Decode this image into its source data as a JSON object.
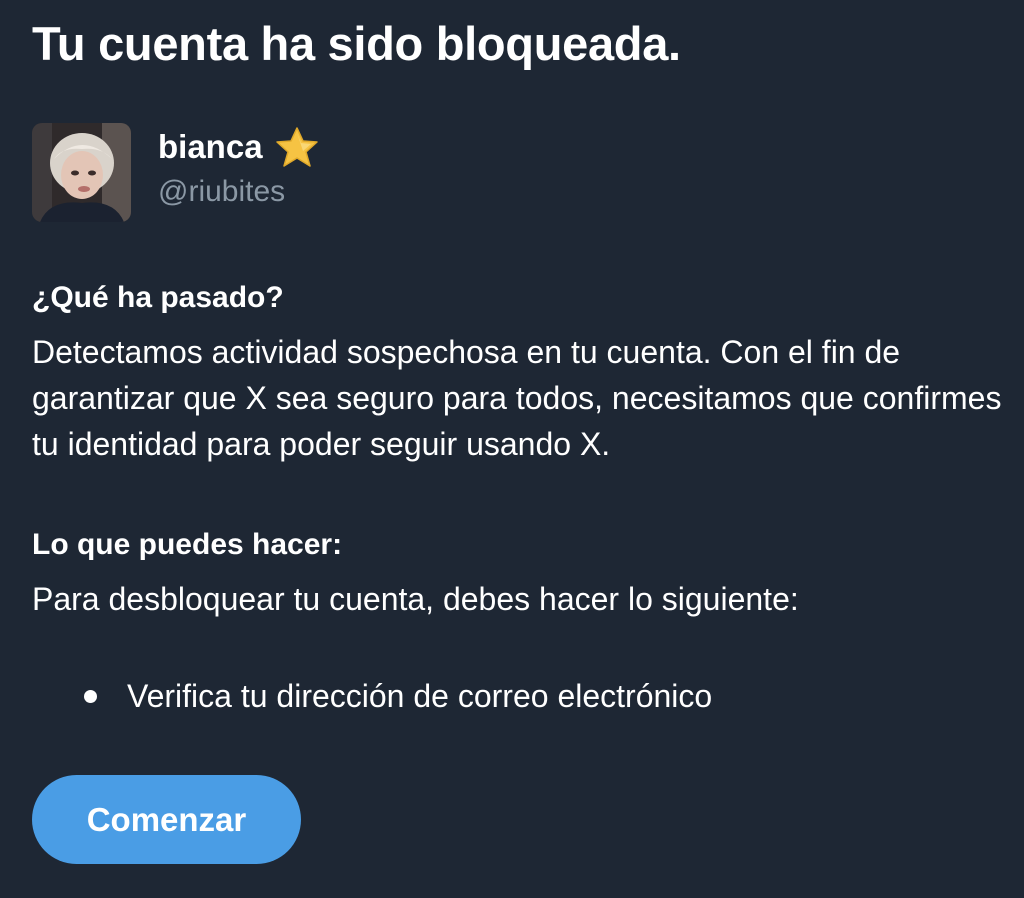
{
  "page": {
    "title": "Tu cuenta ha sido bloqueada."
  },
  "profile": {
    "display_name": "bianca",
    "handle": "@riubites",
    "badge_icon": "star-icon",
    "avatar_icon": "avatar-photo"
  },
  "what_happened": {
    "heading": "¿Qué ha pasado?",
    "body": "Detectamos actividad sospechosa en tu cuenta. Con el fin de garantizar que X sea seguro para todos, necesitamos que confirmes tu identidad para poder seguir usando X."
  },
  "what_you_can_do": {
    "heading": "Lo que puedes hacer:",
    "body": "Para desbloquear tu cuenta, debes hacer lo siguiente:",
    "steps": [
      "Verifica tu dirección de correo electrónico"
    ]
  },
  "actions": {
    "start_label": "Comenzar"
  },
  "colors": {
    "background": "#1e2734",
    "text": "#ffffff",
    "secondary_text": "#8b98a5",
    "accent": "#4a9de5",
    "star": "#f6c343"
  }
}
